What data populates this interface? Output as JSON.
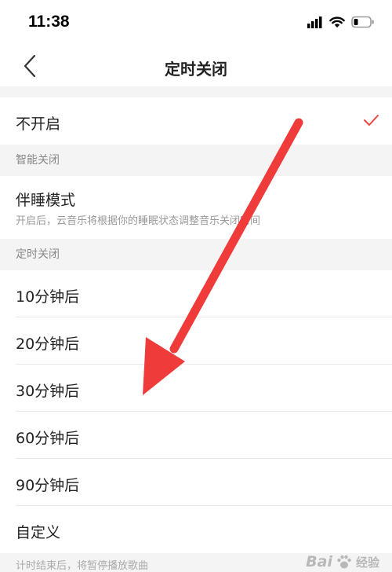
{
  "status_bar": {
    "time": "11:38",
    "icons": [
      "signal-icon",
      "wifi-icon",
      "battery-icon"
    ]
  },
  "nav": {
    "title": "定时关闭",
    "back_icon": "chevron-left-icon"
  },
  "options": {
    "off": {
      "label": "不开启",
      "selected": true
    }
  },
  "smart_section": {
    "header": "智能关闭",
    "sleep_mode": {
      "label": "伴睡模式",
      "description": "开启后，云音乐将根据你的睡眠状态调整音乐关闭时间"
    }
  },
  "timer_section": {
    "header": "定时关闭",
    "items": [
      {
        "label": "10分钟后"
      },
      {
        "label": "20分钟后"
      },
      {
        "label": "30分钟后"
      },
      {
        "label": "60分钟后"
      },
      {
        "label": "90分钟后"
      },
      {
        "label": "自定义"
      }
    ]
  },
  "footer_note": "计时结束后，将暂停播放歌曲",
  "colors": {
    "accent": "#e8463f",
    "arrow": "#f03b3b",
    "section_bg": "#f4f4f4"
  },
  "watermark": {
    "brand": "Bai",
    "suffix": "经验"
  }
}
